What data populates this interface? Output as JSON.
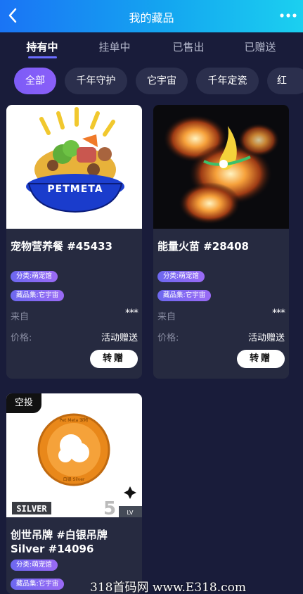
{
  "header": {
    "title": "我的藏品",
    "back_icon": "chevron-left-icon",
    "more_icon": "more-dots-icon"
  },
  "tabs": [
    {
      "label": "持有中",
      "active": true
    },
    {
      "label": "挂单中",
      "active": false
    },
    {
      "label": "已售出",
      "active": false
    },
    {
      "label": "已赠送",
      "active": false
    }
  ],
  "filters": [
    {
      "label": "全部",
      "active": true
    },
    {
      "label": "千年守护",
      "active": false
    },
    {
      "label": "它宇宙",
      "active": false
    },
    {
      "label": "千年定瓷",
      "active": false
    },
    {
      "label": "红",
      "active": false
    }
  ],
  "colors": {
    "background": "#191c3a",
    "card": "#262a40",
    "accent": "#7d5cf7",
    "header_start": "#1a74f5",
    "header_end": "#1bd0f0"
  },
  "items": [
    {
      "name": "宠物营养餐 #45433",
      "category": "分类:萌宠馆",
      "collection": "藏品集:它宇宙",
      "from_label": "来自",
      "from_value": "***",
      "price_label": "价格:",
      "price_value": "活动赠送",
      "action": "转赠",
      "image_text": "PETMETA"
    },
    {
      "name": "能量火苗 #28408",
      "category": "分类:萌宠馆",
      "collection": "藏品集:它宇宙",
      "from_label": "来自",
      "from_value": "***",
      "price_label": "价格:",
      "price_value": "活动赠送",
      "action": "转赠"
    },
    {
      "tag": "空投",
      "name_line1": "创世吊牌 #白银吊牌",
      "name_line2": "Silver #14096",
      "category": "分类:萌宠馆",
      "collection": "藏品集:它宇宙",
      "image_text_silver": "SILVER",
      "image_level": "5",
      "image_level_unit": "LV",
      "medal_top_text": "Pet Meta 宠物",
      "medal_bottom_text": "白银 Silver"
    }
  ],
  "watermark": "318首码网 www.E318.com"
}
